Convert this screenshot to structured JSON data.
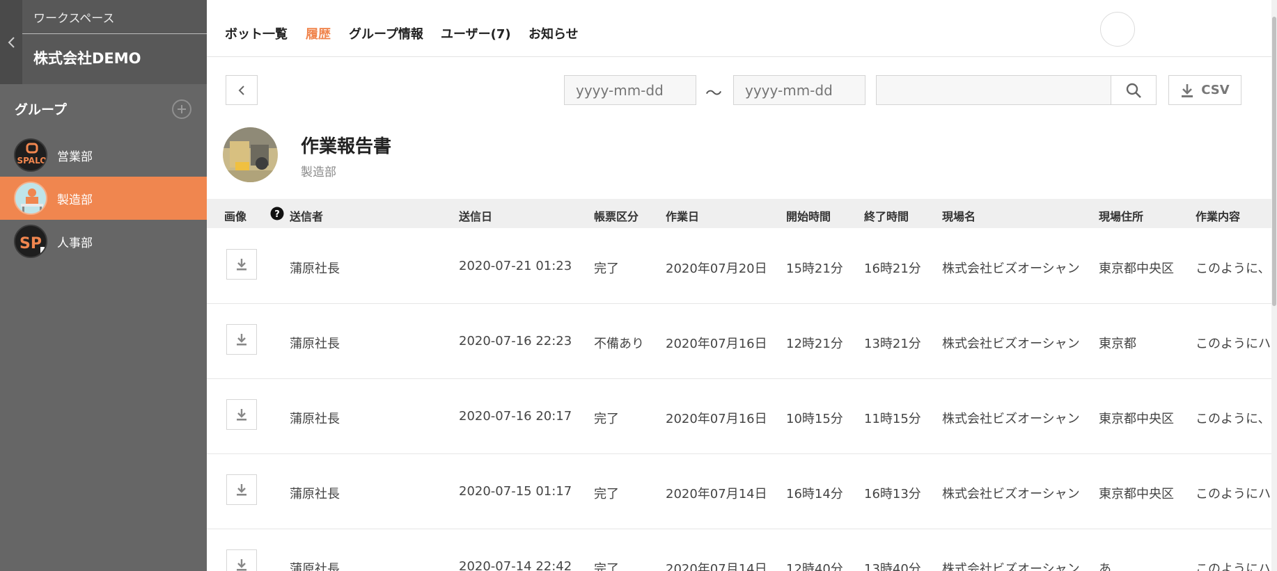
{
  "sidebar": {
    "workspace_label": "ワークスペース",
    "workspace_name": "株式会社DEMO",
    "group_title": "グループ",
    "groups": [
      {
        "label": "営業部",
        "avatar_text": "SPALO"
      },
      {
        "label": "製造部"
      },
      {
        "label": "人事部",
        "avatar_text": "SP"
      }
    ]
  },
  "nav": {
    "tabs": [
      "ボット一覧",
      "履歴",
      "グループ情報",
      "ユーザー(7)",
      "お知らせ"
    ],
    "active_tab": "履歴"
  },
  "toolbar": {
    "date_from_placeholder": "yyyy-mm-dd",
    "date_to_placeholder": "yyyy-mm-dd",
    "separator": "〜",
    "search_placeholder": "",
    "csv_label": "CSV"
  },
  "bot": {
    "title": "作業報告書",
    "group": "製造部"
  },
  "table": {
    "columns": [
      "画像",
      "送信者",
      "送信日",
      "帳票区分",
      "作業日",
      "開始時間",
      "終了時間",
      "現場名",
      "現場住所",
      "作業内容"
    ],
    "rows": [
      {
        "sender": "蒲原社長",
        "sent": "2020-07-21 01:23",
        "type": "完了",
        "work_date": "2020年07月20日",
        "start": "15時21分",
        "end": "16時21分",
        "site": "株式会社ビズオーシャン",
        "address": "東京都中央区",
        "content": "このように、ハ"
      },
      {
        "sender": "蒲原社長",
        "sent": "2020-07-16 22:23",
        "type": "不備あり",
        "work_date": "2020年07月16日",
        "start": "12時21分",
        "end": "13時21分",
        "site": "株式会社ビズオーシャン",
        "address": "東京都",
        "content": "このようにハ"
      },
      {
        "sender": "蒲原社長",
        "sent": "2020-07-16 20:17",
        "type": "完了",
        "work_date": "2020年07月16日",
        "start": "10時15分",
        "end": "11時15分",
        "site": "株式会社ビズオーシャン",
        "address": "東京都中央区",
        "content": "このように、ハ"
      },
      {
        "sender": "蒲原社長",
        "sent": "2020-07-15 01:17",
        "type": "完了",
        "work_date": "2020年07月14日",
        "start": "16時14分",
        "end": "16時13分",
        "site": "株式会社ビズオーシャン",
        "address": "東京都中央区",
        "content": "このようにハ"
      },
      {
        "sender": "蒲原社長",
        "sent": "2020-07-14 22:42",
        "type": "完了",
        "work_date": "2020年07月14日",
        "start": "12時40分",
        "end": "13時40分",
        "site": "株式会社ビズオーシャン",
        "address": "あ",
        "content": "このようにハ"
      }
    ]
  },
  "colors": {
    "accent": "#f0864f",
    "sidebar_bg": "#666666",
    "sidebar_header_bg": "#585858"
  }
}
